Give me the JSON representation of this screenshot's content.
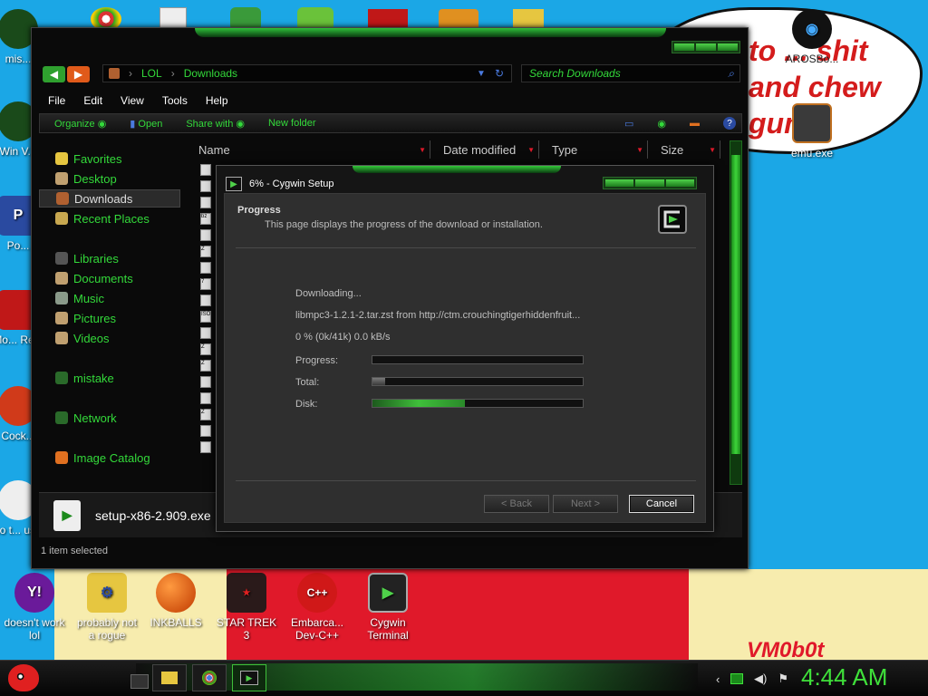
{
  "wallpaper": {
    "bubble_text": "to ... shit and chew gum",
    "signature": "VM0b0t"
  },
  "desktop_icons_left": [
    {
      "label": "mis..."
    },
    {
      "label": "Win V..."
    },
    {
      "label": "Po..."
    },
    {
      "label": "Mo... Re..."
    },
    {
      "label": "Cock..."
    },
    {
      "label": "who t... use..."
    }
  ],
  "desktop_icons_right": [
    {
      "label": "AROSBo..."
    },
    {
      "label": "emu.exe"
    }
  ],
  "desktop_icons_bottom": [
    {
      "label": "doesn't work lol"
    },
    {
      "label": "probably not a rogue"
    },
    {
      "label": "INKBALLS"
    },
    {
      "label": "STAR TREK 3"
    },
    {
      "label": "Embarca... Dev-C++"
    },
    {
      "label": "Cygwin Terminal"
    }
  ],
  "explorer": {
    "address": {
      "part1": "LOL",
      "part2": "Downloads"
    },
    "search_placeholder": "Search Downloads",
    "menu": [
      "File",
      "Edit",
      "View",
      "Tools",
      "Help"
    ],
    "commands": [
      "Organize",
      "Open",
      "Share with",
      "New folder"
    ],
    "nav": [
      {
        "label": "Favorites",
        "color": "#e6c640"
      },
      {
        "label": "Desktop",
        "color": "#c0a070"
      },
      {
        "label": "Downloads",
        "color": "#b06030",
        "selected": true
      },
      {
        "label": "Recent Places",
        "color": "#c8a850"
      },
      {
        "label": "Libraries",
        "color": "#555555"
      },
      {
        "label": "Documents",
        "color": "#c0a070"
      },
      {
        "label": "Music",
        "color": "#8a9a8a"
      },
      {
        "label": "Pictures",
        "color": "#c0a070"
      },
      {
        "label": "Videos",
        "color": "#c0a070"
      },
      {
        "label": "mistake",
        "color": "#2a6a2a"
      },
      {
        "label": "Network",
        "color": "#2a6a2a"
      },
      {
        "label": "Image Catalog",
        "color": "#e07020"
      }
    ],
    "columns": [
      "Name",
      "Date modified",
      "Type",
      "Size"
    ],
    "file_icon_labels": [
      "",
      "",
      "",
      "bz",
      "",
      "Z",
      "",
      "7",
      "",
      "ISO",
      "",
      "Z",
      "Z",
      "",
      "",
      "Z",
      "",
      ""
    ],
    "selected_file": "setup-x86-2.909.exe",
    "status": "1 item selected"
  },
  "dialog": {
    "title": "6% - Cygwin Setup",
    "header_title": "Progress",
    "header_subtitle": "This page displays the progress of the download or installation.",
    "action": "Downloading...",
    "file_line": "libmpc3-1.2.1-2.tar.zst from http://ctm.crouchingtigerhiddenfruit...",
    "stats": "0 %  (0k/41k)  0.0 kB/s",
    "labels": {
      "progress": "Progress:",
      "total": "Total:",
      "disk": "Disk:"
    },
    "progress_values": {
      "progress": 0,
      "total": 0.06,
      "disk": 0.44
    },
    "buttons": {
      "back": "< Back",
      "next": "Next >",
      "cancel": "Cancel"
    }
  },
  "taskbar": {
    "clock": "4:44 AM"
  }
}
